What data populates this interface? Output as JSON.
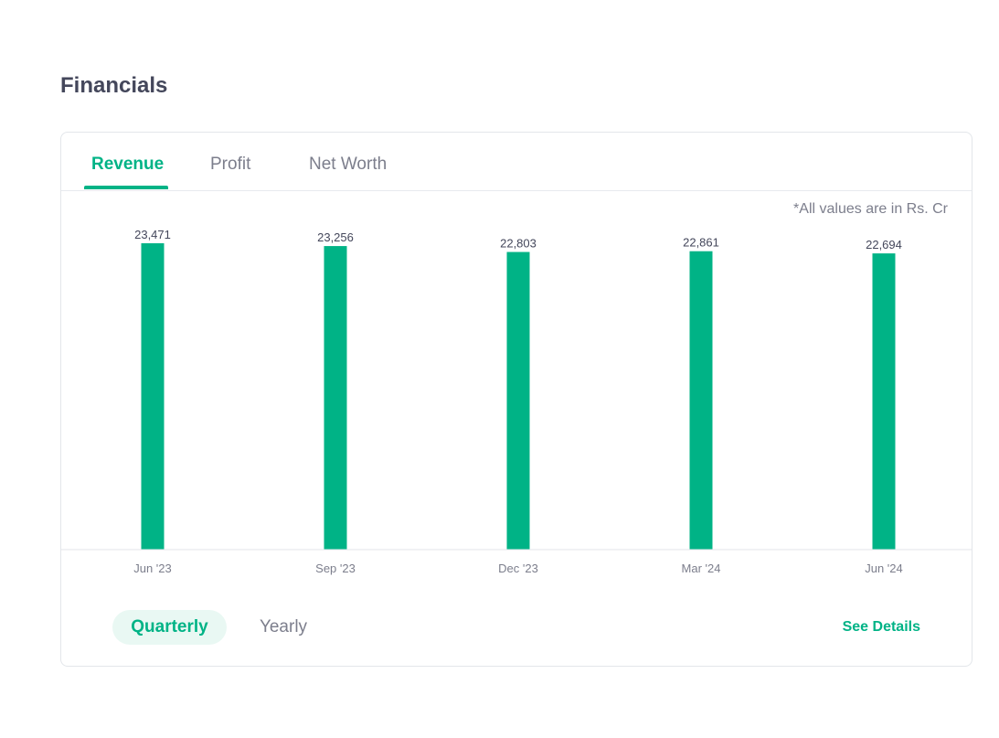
{
  "section": {
    "title": "Financials"
  },
  "tabs": [
    {
      "label": "Revenue",
      "active": true
    },
    {
      "label": "Profit",
      "active": false
    },
    {
      "label": "Net Worth",
      "active": false
    }
  ],
  "units_note": "*All values are in Rs. Cr",
  "period_toggle": {
    "quarterly_label": "Quarterly",
    "yearly_label": "Yearly",
    "selected": "Quarterly"
  },
  "see_details_label": "See Details",
  "colors": {
    "accent": "#00b386",
    "text_muted": "#7c7e8c",
    "text_dark": "#44475b"
  },
  "chart_data": {
    "type": "bar",
    "categories": [
      "Jun '23",
      "Sep '23",
      "Dec '23",
      "Mar '24",
      "Jun '24"
    ],
    "values": [
      23471,
      23256,
      22803,
      22861,
      22694
    ],
    "data_labels": [
      "23,471",
      "23,256",
      "22,803",
      "22,861",
      "22,694"
    ],
    "title": "",
    "xlabel": "",
    "ylabel": "",
    "ylim": [
      0,
      23471
    ],
    "grid": false,
    "legend": "none"
  }
}
